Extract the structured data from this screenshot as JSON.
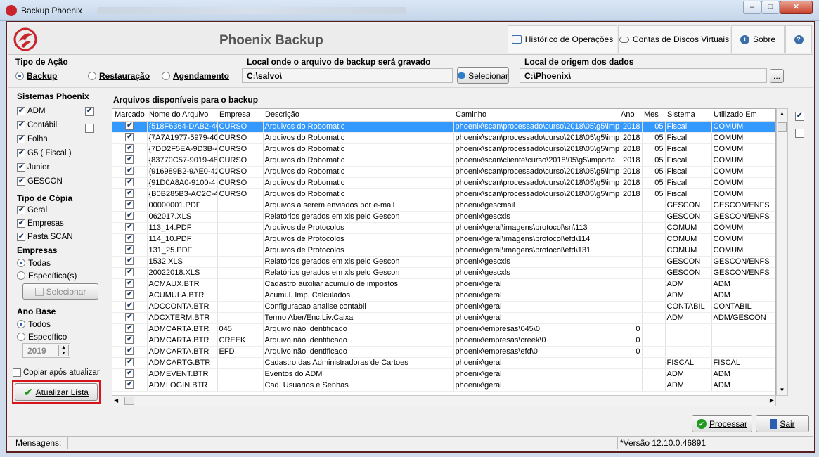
{
  "window": {
    "title": "Backup Phoenix",
    "min": "–",
    "max": "□",
    "close": "✕"
  },
  "header": {
    "app_title": "Phoenix Backup",
    "btn_history": "Histórico de Operações",
    "btn_accounts": "Contas de Discos Virtuais",
    "btn_about": "Sobre",
    "help": "?"
  },
  "action": {
    "label": "Tipo de Ação",
    "backup": "Backup",
    "restore": "Restauração",
    "schedule": "Agendamento",
    "selected": "backup"
  },
  "dest": {
    "label": "Local onde o arquivo de backup será gravado",
    "value": "C:\\salvo\\",
    "btn": "Selecionar"
  },
  "origin": {
    "label": "Local de origem dos dados",
    "value": "C:\\Phoenix\\",
    "btn": "..."
  },
  "systems": {
    "label": "Sistemas Phoenix",
    "items": [
      {
        "label": "ADM",
        "checked": true
      },
      {
        "label": "Contábil",
        "checked": true
      },
      {
        "label": "Folha",
        "checked": true
      },
      {
        "label": "G5 ( Fiscal )",
        "checked": true
      },
      {
        "label": "Junior",
        "checked": true
      },
      {
        "label": "GESCON",
        "checked": true
      }
    ],
    "toggle_all_checked": true,
    "toggle_none_checked": false
  },
  "copy_type": {
    "label": "Tipo de Cópia",
    "items": [
      {
        "label": "Geral",
        "checked": true
      },
      {
        "label": "Empresas",
        "checked": true
      },
      {
        "label": "Pasta SCAN",
        "checked": true
      }
    ]
  },
  "companies": {
    "label": "Empresas",
    "all": "Todas",
    "specific": "Específica(s)",
    "btn": "Selecionar",
    "selected": "all"
  },
  "year": {
    "label": "Ano Base",
    "all": "Todos",
    "specific": "Específico",
    "value": "2019",
    "selected": "all"
  },
  "copy_after": {
    "label": "Copiar após atualizar",
    "checked": false
  },
  "refresh_btn": "Atualizar Lista",
  "files": {
    "label": "Arquivos disponíveis para o backup",
    "columns": [
      "Marcado",
      "Nome do Arquivo",
      "Empresa",
      "Descrição",
      "Caminho",
      "Ano",
      "Mes",
      "Sistema",
      "Utilizado Em"
    ],
    "rows": [
      {
        "name": "{518F6364-DAB2-40",
        "emp": "CURSO",
        "desc": "Arquivos do Robomatic",
        "path": "phoenix\\scan\\processado\\curso\\2018\\05\\g5\\imp",
        "ano": "2018",
        "mes": "05",
        "sis": "Fiscal",
        "uso": "COMUM",
        "sel": true
      },
      {
        "name": "{7A7A1977-5979-40",
        "emp": "CURSO",
        "desc": "Arquivos do Robomatic",
        "path": "phoenix\\scan\\processado\\curso\\2018\\05\\g5\\imp",
        "ano": "2018",
        "mes": "05",
        "sis": "Fiscal",
        "uso": "COMUM"
      },
      {
        "name": "{7DD2F5EA-9D3B-4",
        "emp": "CURSO",
        "desc": "Arquivos do Robomatic",
        "path": "phoenix\\scan\\processado\\curso\\2018\\05\\g5\\imp",
        "ano": "2018",
        "mes": "05",
        "sis": "Fiscal",
        "uso": "COMUM"
      },
      {
        "name": "{83770C57-9019-48",
        "emp": "CURSO",
        "desc": "Arquivos do Robomatic",
        "path": "phoenix\\scan\\cliente\\curso\\2018\\05\\g5\\importa",
        "ano": "2018",
        "mes": "05",
        "sis": "Fiscal",
        "uso": "COMUM"
      },
      {
        "name": "{916989B2-9AE0-42",
        "emp": "CURSO",
        "desc": "Arquivos do Robomatic",
        "path": "phoenix\\scan\\processado\\curso\\2018\\05\\g5\\imp",
        "ano": "2018",
        "mes": "05",
        "sis": "Fiscal",
        "uso": "COMUM"
      },
      {
        "name": "{91D0A8A0-9100-4",
        "emp": "CURSO",
        "desc": "Arquivos do Robomatic",
        "path": "phoenix\\scan\\processado\\curso\\2018\\05\\g5\\imp",
        "ano": "2018",
        "mes": "05",
        "sis": "Fiscal",
        "uso": "COMUM"
      },
      {
        "name": "{B0B285B3-AC2C-4",
        "emp": "CURSO",
        "desc": "Arquivos do Robomatic",
        "path": "phoenix\\scan\\processado\\curso\\2018\\05\\g5\\imp",
        "ano": "2018",
        "mes": "05",
        "sis": "Fiscal",
        "uso": "COMUM"
      },
      {
        "name": "00000001.PDF",
        "emp": "",
        "desc": "Arquivos a serem enviados por e-mail",
        "path": "phoenix\\gescmail",
        "ano": "",
        "mes": "",
        "sis": "GESCON",
        "uso": "GESCON/ENFS"
      },
      {
        "name": "062017.XLS",
        "emp": "",
        "desc": "Relatórios gerados em xls pelo Gescon",
        "path": "phoenix\\gescxls",
        "ano": "",
        "mes": "",
        "sis": "GESCON",
        "uso": "GESCON/ENFS"
      },
      {
        "name": "113_14.PDF",
        "emp": "",
        "desc": "Arquivos de Protocolos",
        "path": "phoenix\\geral\\imagens\\protocol\\sn\\113",
        "ano": "",
        "mes": "",
        "sis": "COMUM",
        "uso": "COMUM"
      },
      {
        "name": "114_10.PDF",
        "emp": "",
        "desc": "Arquivos de Protocolos",
        "path": "phoenix\\geral\\imagens\\protocol\\efd\\114",
        "ano": "",
        "mes": "",
        "sis": "COMUM",
        "uso": "COMUM"
      },
      {
        "name": "131_25.PDF",
        "emp": "",
        "desc": "Arquivos de Protocolos",
        "path": "phoenix\\geral\\imagens\\protocol\\efd\\131",
        "ano": "",
        "mes": "",
        "sis": "COMUM",
        "uso": "COMUM"
      },
      {
        "name": "1532.XLS",
        "emp": "",
        "desc": "Relatórios gerados em xls pelo Gescon",
        "path": "phoenix\\gescxls",
        "ano": "",
        "mes": "",
        "sis": "GESCON",
        "uso": "GESCON/ENFS"
      },
      {
        "name": "20022018.XLS",
        "emp": "",
        "desc": "Relatórios gerados em xls pelo Gescon",
        "path": "phoenix\\gescxls",
        "ano": "",
        "mes": "",
        "sis": "GESCON",
        "uso": "GESCON/ENFS"
      },
      {
        "name": "ACMAUX.BTR",
        "emp": "",
        "desc": "Cadastro auxiliar acumulo de impostos",
        "path": "phoenix\\geral",
        "ano": "",
        "mes": "",
        "sis": "ADM",
        "uso": "ADM"
      },
      {
        "name": "ACUMULA.BTR",
        "emp": "",
        "desc": "Acumul. Imp. Calculados",
        "path": "phoenix\\geral",
        "ano": "",
        "mes": "",
        "sis": "ADM",
        "uso": "ADM"
      },
      {
        "name": "ADCCONTA.BTR",
        "emp": "",
        "desc": "Configuracao analise contabil",
        "path": "phoenix\\geral",
        "ano": "",
        "mes": "",
        "sis": "CONTABIL",
        "uso": "CONTABIL"
      },
      {
        "name": "ADCXTERM.BTR",
        "emp": "",
        "desc": "Termo Aber/Enc.Liv.Caixa",
        "path": "phoenix\\geral",
        "ano": "",
        "mes": "",
        "sis": "ADM",
        "uso": "ADM/GESCON"
      },
      {
        "name": "ADMCARTA.BTR",
        "emp": "045",
        "desc": "Arquivo não identificado",
        "path": "phoenix\\empresas\\045\\0",
        "ano": "0",
        "mes": "",
        "sis": "",
        "uso": ""
      },
      {
        "name": "ADMCARTA.BTR",
        "emp": "CREEK",
        "desc": "Arquivo não identificado",
        "path": "phoenix\\empresas\\creek\\0",
        "ano": "0",
        "mes": "",
        "sis": "",
        "uso": ""
      },
      {
        "name": "ADMCARTA.BTR",
        "emp": "EFD",
        "desc": "Arquivo não identificado",
        "path": "phoenix\\empresas\\efd\\0",
        "ano": "0",
        "mes": "",
        "sis": "",
        "uso": ""
      },
      {
        "name": "ADMCARTG.BTR",
        "emp": "",
        "desc": "Cadastro das Administradoras de Cartoes",
        "path": "phoenix\\geral",
        "ano": "",
        "mes": "",
        "sis": "FISCAL",
        "uso": "FISCAL"
      },
      {
        "name": "ADMEVENT.BTR",
        "emp": "",
        "desc": "Eventos do ADM",
        "path": "phoenix\\geral",
        "ano": "",
        "mes": "",
        "sis": "ADM",
        "uso": "ADM"
      },
      {
        "name": "ADMLOGIN.BTR",
        "emp": "",
        "desc": "Cad. Usuarios e Senhas",
        "path": "phoenix\\geral",
        "ano": "",
        "mes": "",
        "sis": "ADM",
        "uso": "ADM"
      }
    ]
  },
  "right_toggles": {
    "all": true,
    "none": false
  },
  "footer": {
    "process": "Processar",
    "exit": "Sair",
    "messages": "Mensagens:",
    "version": "*Versão 12.10.0.46891"
  }
}
